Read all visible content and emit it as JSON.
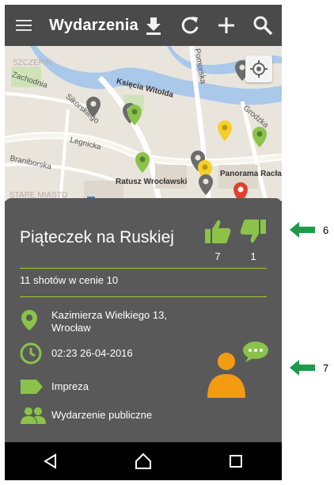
{
  "app_bar": {
    "title": "Wydarzenia",
    "actions": [
      "download-icon",
      "refresh-icon",
      "plus-icon",
      "search-icon"
    ]
  },
  "map": {
    "labels": {
      "zachodnia": "Zachodnia",
      "sikorskiego": "Sikorskiego",
      "ksiecia": "Księcia Witolda",
      "legnicka": "Legnicka",
      "braniborska": "Braniborska",
      "ratusz": "Ratusz Wrocławski",
      "panorama": "Panorama Racław",
      "stare_miasto": "STARE MIASTO",
      "szczepin": "SZCZEPIN",
      "pomorska": "Pomorska",
      "grodzka": "Grodzka"
    }
  },
  "event": {
    "title": "Piąteczek na Ruskiej",
    "likes": "7",
    "dislikes": "1",
    "description": "11 shotów w cenie 10",
    "address_line1": "Kazimierza Wielkiego 13,",
    "address_line2": "Wrocław",
    "datetime": "02:23 26-04-2016",
    "category": "Impreza",
    "visibility": "Wydarzenie publiczne"
  },
  "callouts": {
    "first": "6",
    "second": "7"
  },
  "colors": {
    "accent_green": "#8bc34a",
    "appbar": "#4a4a4a",
    "sheet": "#595959",
    "organizer_orange": "#f39c12",
    "callout_arrow": "#1e9a4a"
  }
}
